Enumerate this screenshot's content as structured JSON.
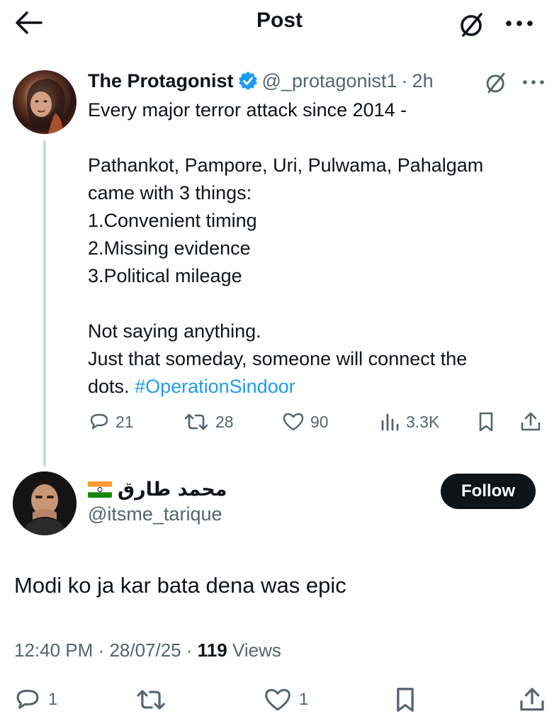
{
  "header": {
    "title": "Post",
    "icons": {
      "back": "arrow-left-icon",
      "grok": "grok-icon",
      "more": "more-horizontal-icon"
    }
  },
  "parent_post": {
    "author_name": "The Protagonist",
    "verified": true,
    "handle": "@_protagonist1",
    "separator": "·",
    "time": "2h",
    "lines": [
      "Every major terror attack since 2014 -",
      "",
      "Pathankot, Pampore, Uri, Pulwama, Pahalgam",
      "came with 3 things:",
      "1.Convenient timing",
      "2.Missing evidence",
      "3.Political mileage",
      "",
      "Not saying anything.",
      "Just that someday, someone will connect the"
    ],
    "last_line_text": "dots.",
    "hashtag": "#OperationSindoor",
    "stats": {
      "replies": "21",
      "reposts": "28",
      "likes": "90",
      "views": "3.3K"
    }
  },
  "main_post": {
    "author_name": "محمد طارق",
    "flag": "india-flag-icon",
    "handle": "@itsme_tarique",
    "follow_label": "Follow",
    "text": "Modi ko ja kar bata dena was epic",
    "time": "12:40 PM",
    "date": "28/07/25",
    "separator": "·",
    "views_count": "119",
    "views_label": "Views",
    "stats": {
      "replies": "1",
      "likes": "1"
    }
  },
  "colors": {
    "accent": "#1d9bf0",
    "text": "#0f1419",
    "muted": "#536471",
    "thread_line": "#cfd9de"
  }
}
